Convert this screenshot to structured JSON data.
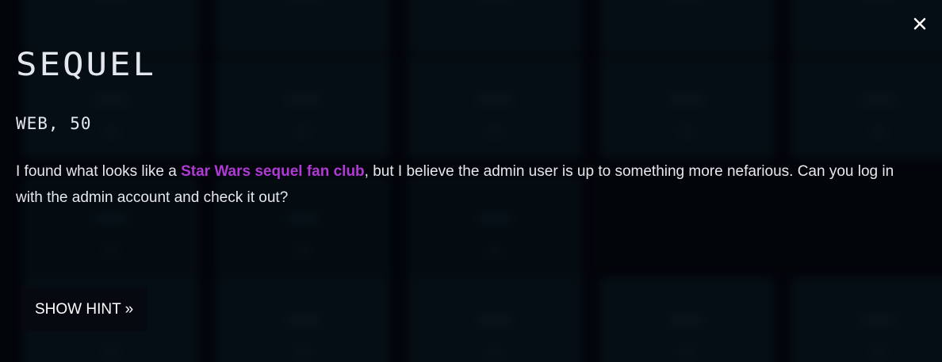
{
  "challenge": {
    "title": "SEQUEL",
    "category_points": "WEB, 50",
    "description": {
      "before_link": "I found what looks like a ",
      "link_text": "Star Wars sequel fan club",
      "after_link": ", but I believe the admin user is up to something more nefarious. Can you log in with the admin account and check it out?"
    },
    "hint_button_label": "SHOW HINT »"
  },
  "controls": {
    "close_icon": "close-icon"
  },
  "colors": {
    "link": "#b13ad6",
    "text": "#e6e8ee",
    "background": "#04070d",
    "button_bg": "#060a10"
  }
}
